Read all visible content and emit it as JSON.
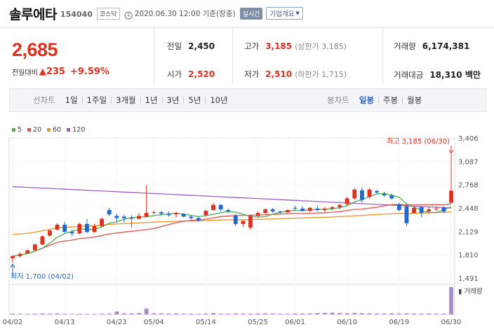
{
  "header": {
    "name": "솔루에타",
    "code": "154040",
    "market": "코스닥",
    "datetime": "2020.06.30 12:00 기준(장중)",
    "realtime_label": "실시간",
    "company_label": "기업개요"
  },
  "quote": {
    "price": "2,685",
    "change_label": "전일대비",
    "change": "235",
    "change_pct": "+9.59%",
    "prev_close_label": "전일",
    "prev_close": "2,450",
    "open_label": "시가",
    "open": "2,520",
    "high_label": "고가",
    "high": "3,185",
    "upper_limit": "(상한가 3,185)",
    "low_label": "저가",
    "low": "2,510",
    "lower_limit": "(하한가 1,715)",
    "volume_label": "거래량",
    "volume": "6,174,381",
    "amount_label": "거래대금",
    "amount": "18,310 백만",
    "accent_up": "#e0301e"
  },
  "periods": {
    "line_label": "선차트",
    "line_items": [
      "1일",
      "1주일",
      "3개월",
      "1년",
      "3년",
      "5년",
      "10년"
    ],
    "candle_label": "봉차트",
    "candle_items": [
      "일봉",
      "주봉",
      "월봉"
    ],
    "active_candle": "일봉"
  },
  "chart_data": {
    "type": "candlestick",
    "legend": [
      {
        "name": "5",
        "color": "#4caf50"
      },
      {
        "name": "20",
        "color": "#e0514a"
      },
      {
        "name": "60",
        "color": "#f0902a"
      },
      {
        "name": "120",
        "color": "#9b5fc0"
      }
    ],
    "y_ticks": [
      "3,406",
      "3,087",
      "2,768",
      "2,448",
      "2,129",
      "1,810",
      "1,491"
    ],
    "y_values": [
      3406,
      3087,
      2768,
      2448,
      2129,
      1810,
      1491
    ],
    "ylim": [
      1491,
      3406
    ],
    "x_ticks": [
      "04/02",
      "04/13",
      "04/23",
      "05/04",
      "05/14",
      "05/25",
      "06/01",
      "06/10",
      "06/19",
      "06/30"
    ],
    "max_label": "최고 3,185 (06/30)",
    "min_label": "최저 1,700 (04/02)",
    "volume_label": "거래량",
    "up_color": "#e0301e",
    "down_color": "#1f67d1",
    "candles": [
      {
        "d": "04/02",
        "o": 1760,
        "h": 1800,
        "l": 1700,
        "c": 1790
      },
      {
        "d": "04/03",
        "o": 1790,
        "h": 1840,
        "l": 1770,
        "c": 1820
      },
      {
        "d": "04/06",
        "o": 1830,
        "h": 1880,
        "l": 1820,
        "c": 1870
      },
      {
        "d": "04/07",
        "o": 1870,
        "h": 1960,
        "l": 1860,
        "c": 1950
      },
      {
        "d": "04/08",
        "o": 1950,
        "h": 2080,
        "l": 1940,
        "c": 2060
      },
      {
        "d": "04/09",
        "o": 2070,
        "h": 2160,
        "l": 2060,
        "c": 2140
      },
      {
        "d": "04/10",
        "o": 2150,
        "h": 2240,
        "l": 2140,
        "c": 2220
      },
      {
        "d": "04/13",
        "o": 2220,
        "h": 2260,
        "l": 2110,
        "c": 2120
      },
      {
        "d": "04/14",
        "o": 2120,
        "h": 2150,
        "l": 2060,
        "c": 2100
      },
      {
        "d": "04/16",
        "o": 2100,
        "h": 2250,
        "l": 2090,
        "c": 2230
      },
      {
        "d": "04/17",
        "o": 2230,
        "h": 2300,
        "l": 2100,
        "c": 2120
      },
      {
        "d": "04/20",
        "o": 2120,
        "h": 2230,
        "l": 2110,
        "c": 2200
      },
      {
        "d": "04/21",
        "o": 2200,
        "h": 2320,
        "l": 2190,
        "c": 2300
      },
      {
        "d": "04/22",
        "o": 2420,
        "h": 2450,
        "l": 2340,
        "c": 2360
      },
      {
        "d": "04/23",
        "o": 2340,
        "h": 2370,
        "l": 2260,
        "c": 2310
      },
      {
        "d": "04/24",
        "o": 2330,
        "h": 2360,
        "l": 2250,
        "c": 2310
      },
      {
        "d": "04/27",
        "o": 2320,
        "h": 2350,
        "l": 2180,
        "c": 2300
      },
      {
        "d": "04/28",
        "o": 2300,
        "h": 2380,
        "l": 2290,
        "c": 2340
      },
      {
        "d": "04/29",
        "o": 2330,
        "h": 2760,
        "l": 2320,
        "c": 2380
      },
      {
        "d": "05/04",
        "o": 2380,
        "h": 2410,
        "l": 2360,
        "c": 2390
      },
      {
        "d": "05/06",
        "o": 2390,
        "h": 2410,
        "l": 2340,
        "c": 2370
      },
      {
        "d": "05/07",
        "o": 2370,
        "h": 2400,
        "l": 2330,
        "c": 2350
      },
      {
        "d": "05/08",
        "o": 2360,
        "h": 2400,
        "l": 2320,
        "c": 2380
      },
      {
        "d": "05/11",
        "o": 2370,
        "h": 2380,
        "l": 2320,
        "c": 2330
      },
      {
        "d": "05/12",
        "o": 2330,
        "h": 2350,
        "l": 2290,
        "c": 2310
      },
      {
        "d": "05/13",
        "o": 2310,
        "h": 2330,
        "l": 2260,
        "c": 2280
      },
      {
        "d": "05/14",
        "o": 2350,
        "h": 2420,
        "l": 2340,
        "c": 2410
      },
      {
        "d": "05/15",
        "o": 2420,
        "h": 2520,
        "l": 2410,
        "c": 2490
      },
      {
        "d": "05/18",
        "o": 2490,
        "h": 2500,
        "l": 2400,
        "c": 2430
      },
      {
        "d": "05/19",
        "o": 2420,
        "h": 2440,
        "l": 2380,
        "c": 2400
      },
      {
        "d": "05/20",
        "o": 2350,
        "h": 2370,
        "l": 2200,
        "c": 2230
      },
      {
        "d": "05/21",
        "o": 2230,
        "h": 2280,
        "l": 2190,
        "c": 2270
      },
      {
        "d": "05/22",
        "o": 2180,
        "h": 2360,
        "l": 2150,
        "c": 2340
      },
      {
        "d": "05/25",
        "o": 2340,
        "h": 2400,
        "l": 2320,
        "c": 2380
      },
      {
        "d": "05/26",
        "o": 2380,
        "h": 2440,
        "l": 2370,
        "c": 2430
      },
      {
        "d": "05/27",
        "o": 2430,
        "h": 2450,
        "l": 2380,
        "c": 2400
      },
      {
        "d": "05/28",
        "o": 2400,
        "h": 2410,
        "l": 2370,
        "c": 2390
      },
      {
        "d": "05/29",
        "o": 2390,
        "h": 2430,
        "l": 2380,
        "c": 2420
      },
      {
        "d": "06/01",
        "o": 2450,
        "h": 2480,
        "l": 2420,
        "c": 2440
      },
      {
        "d": "06/02",
        "o": 2440,
        "h": 2470,
        "l": 2400,
        "c": 2410
      },
      {
        "d": "06/03",
        "o": 2410,
        "h": 2460,
        "l": 2390,
        "c": 2450
      },
      {
        "d": "06/04",
        "o": 2440,
        "h": 2480,
        "l": 2400,
        "c": 2420
      },
      {
        "d": "06/05",
        "o": 2420,
        "h": 2460,
        "l": 2380,
        "c": 2440
      },
      {
        "d": "06/08",
        "o": 2440,
        "h": 2470,
        "l": 2420,
        "c": 2460
      },
      {
        "d": "06/09",
        "o": 2460,
        "h": 2500,
        "l": 2430,
        "c": 2490
      },
      {
        "d": "06/10",
        "o": 2500,
        "h": 2600,
        "l": 2480,
        "c": 2580
      },
      {
        "d": "06/11",
        "o": 2580,
        "h": 2720,
        "l": 2560,
        "c": 2700
      },
      {
        "d": "06/12",
        "o": 2690,
        "h": 2730,
        "l": 2520,
        "c": 2560
      },
      {
        "d": "06/15",
        "o": 2600,
        "h": 2720,
        "l": 2580,
        "c": 2700
      },
      {
        "d": "06/16",
        "o": 2680,
        "h": 2700,
        "l": 2640,
        "c": 2660
      },
      {
        "d": "06/17",
        "o": 2640,
        "h": 2670,
        "l": 2600,
        "c": 2620
      },
      {
        "d": "06/18",
        "o": 2620,
        "h": 2640,
        "l": 2560,
        "c": 2580
      },
      {
        "d": "06/19",
        "o": 2500,
        "h": 2520,
        "l": 2400,
        "c": 2420
      },
      {
        "d": "06/22",
        "o": 2470,
        "h": 2490,
        "l": 2200,
        "c": 2240
      },
      {
        "d": "06/23",
        "o": 2380,
        "h": 2460,
        "l": 2370,
        "c": 2450
      },
      {
        "d": "06/24",
        "o": 2460,
        "h": 2470,
        "l": 2320,
        "c": 2380
      },
      {
        "d": "06/25",
        "o": 2400,
        "h": 2460,
        "l": 2370,
        "c": 2430
      },
      {
        "d": "06/26",
        "o": 2430,
        "h": 2470,
        "l": 2410,
        "c": 2440
      },
      {
        "d": "06/29",
        "o": 2450,
        "h": 2470,
        "l": 2380,
        "c": 2400
      },
      {
        "d": "06/30",
        "o": 2520,
        "h": 3185,
        "l": 2510,
        "c": 2685
      }
    ],
    "volumes": [
      8,
      6,
      5,
      7,
      9,
      8,
      10,
      6,
      5,
      7,
      6,
      5,
      8,
      9,
      30,
      12,
      10,
      14,
      60,
      12,
      10,
      9,
      11,
      8,
      7,
      6,
      9,
      14,
      8,
      7,
      10,
      9,
      8,
      10,
      11,
      9,
      7,
      8,
      10,
      9,
      11,
      14,
      16,
      18,
      15,
      12,
      14,
      13,
      11,
      10,
      9,
      12,
      10,
      11,
      9,
      8,
      10,
      9,
      8,
      280
    ]
  }
}
